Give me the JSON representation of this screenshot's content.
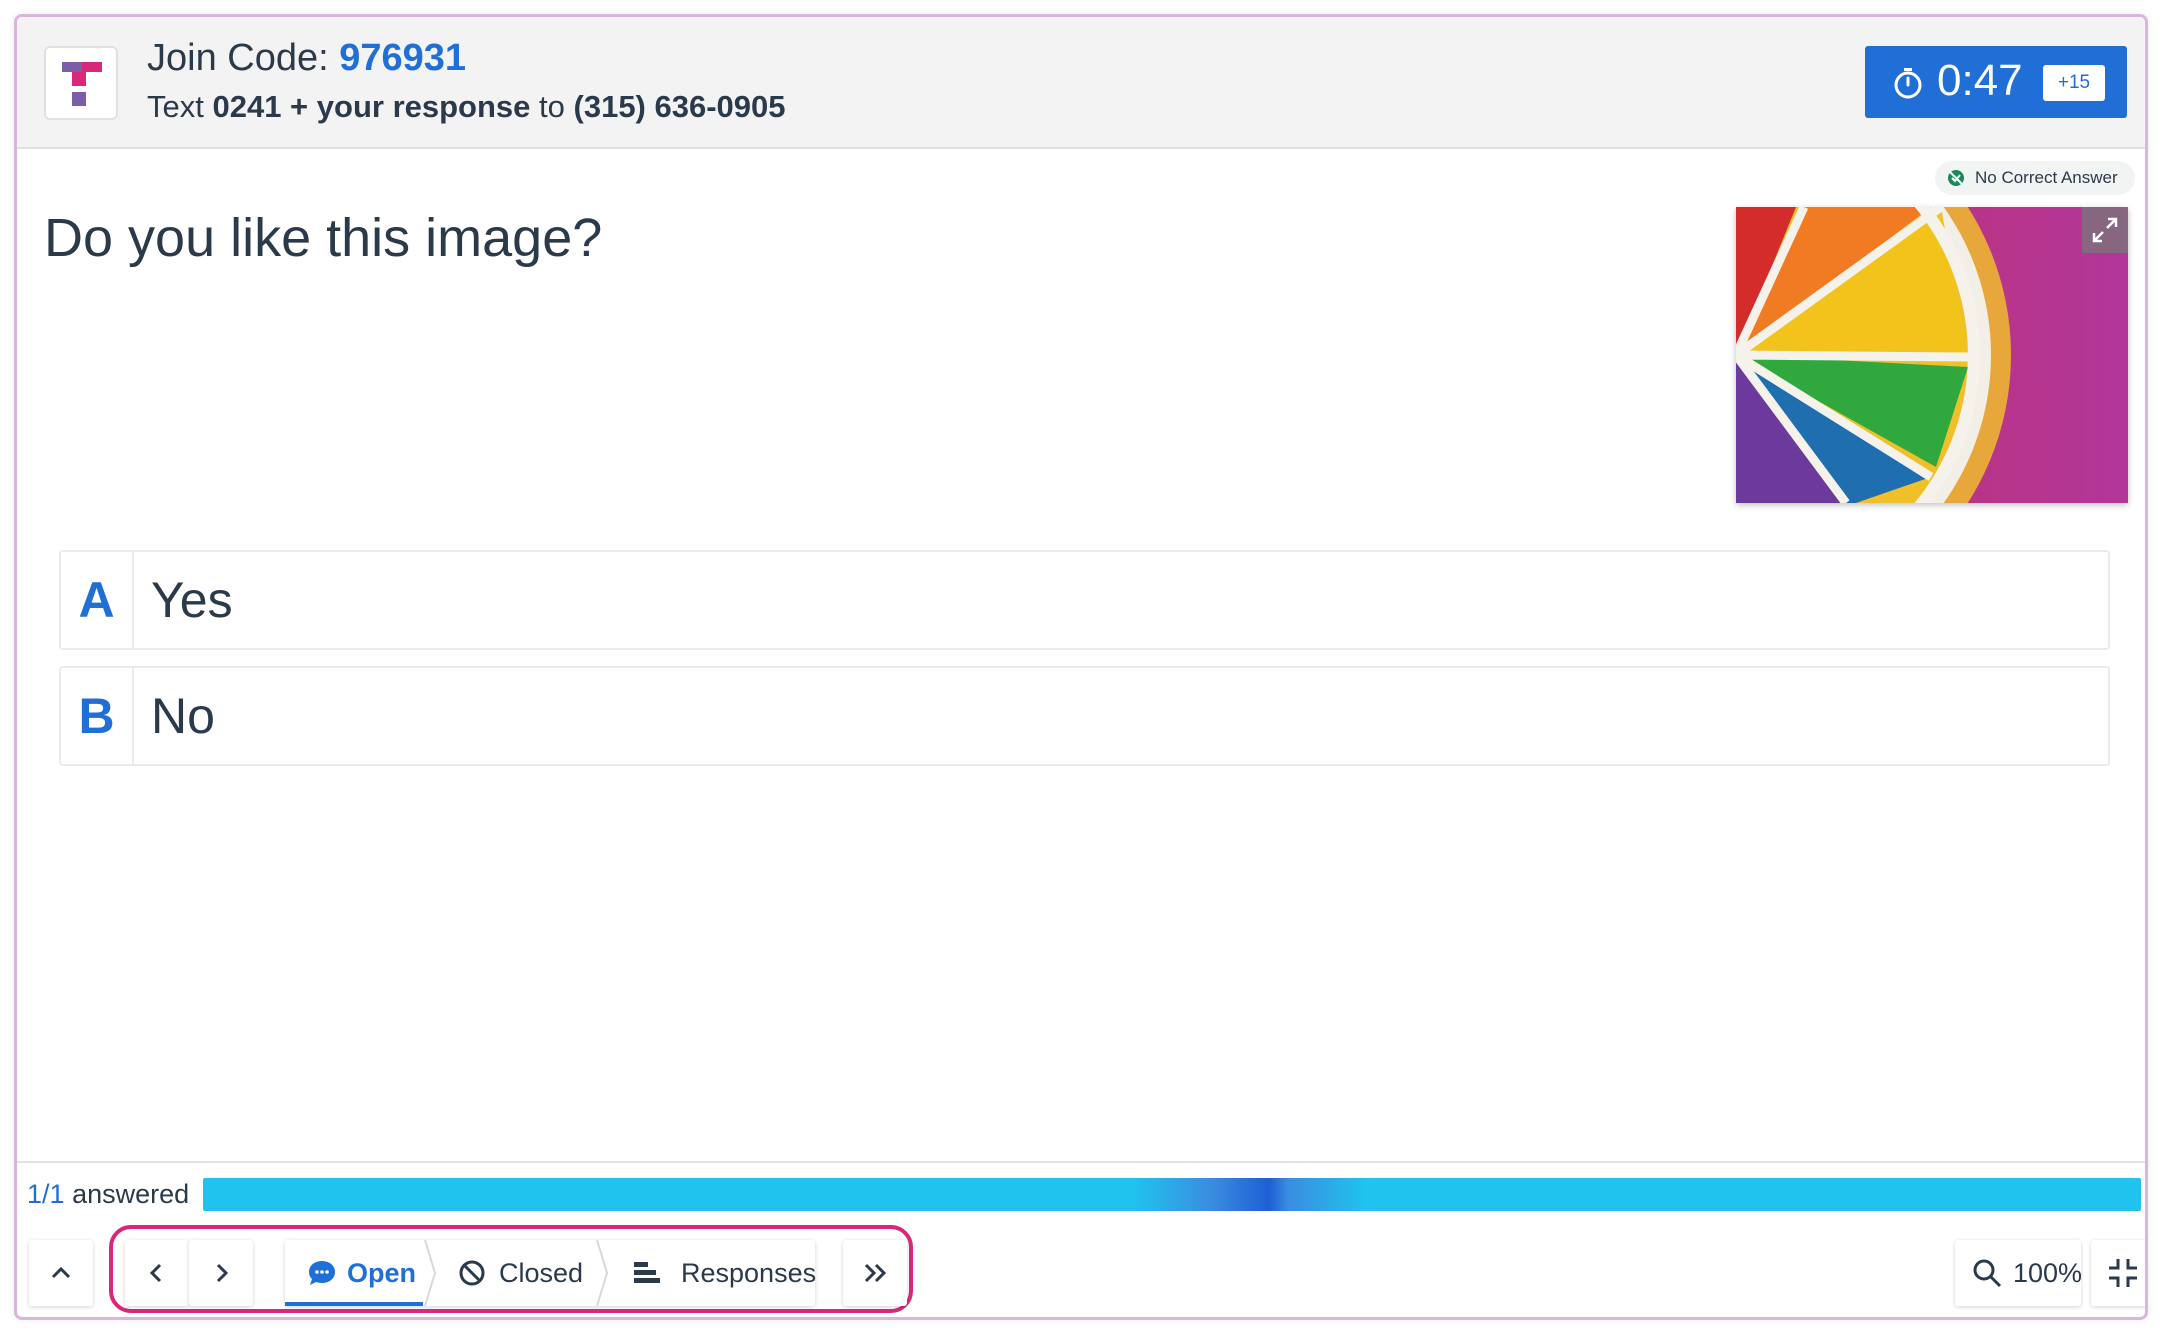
{
  "header": {
    "join_label": "Join Code:",
    "join_code": "976931",
    "text_prefix": "Text",
    "text_code": "0241 + your response",
    "text_to": "to",
    "phone": "(315) 636-0905"
  },
  "timer": {
    "value": "0:47",
    "add_label": "+15"
  },
  "badge": {
    "label": "No Correct Answer"
  },
  "question": {
    "text": "Do you like this image?"
  },
  "options": [
    {
      "letter": "A",
      "label": "Yes"
    },
    {
      "letter": "B",
      "label": "No"
    }
  ],
  "footer": {
    "answered_count": "1/1",
    "answered_label": "answered",
    "progress_percent": 100,
    "states": {
      "open": "Open",
      "closed": "Closed",
      "responses": "Responses"
    },
    "zoom": "100%"
  },
  "colors": {
    "accent": "#1f6fd6",
    "progress": "#1fc3ee",
    "highlight": "#d7287a"
  }
}
